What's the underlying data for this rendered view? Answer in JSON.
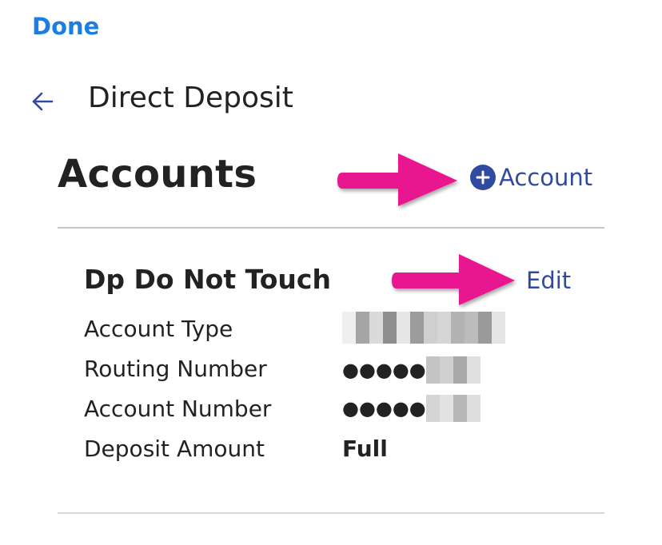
{
  "nav": {
    "done_label": "Done",
    "back_icon": "arrow-left-icon",
    "title": "Direct Deposit"
  },
  "section": {
    "title": "Accounts",
    "add_account_label": "Account",
    "add_account_icon": "plus-circle-icon"
  },
  "account": {
    "name": "Dp Do Not Touch",
    "edit_label": "Edit",
    "rows": [
      {
        "label": "Account Type",
        "value": ""
      },
      {
        "label": "Routing Number",
        "value": "●●●●●"
      },
      {
        "label": "Account Number",
        "value": "●●●●●"
      },
      {
        "label": "Deposit Amount",
        "value": "Full"
      }
    ]
  },
  "colors": {
    "accent_blue": "#1a7ee6",
    "link_navy": "#2f4aa0",
    "annotation_pink": "#e8158f",
    "divider": "#c9c4c0"
  }
}
